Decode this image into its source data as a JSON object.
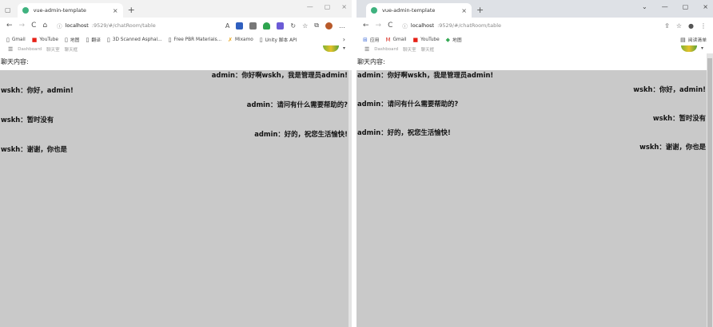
{
  "left_window": {
    "tab_title": "vue-admin-template",
    "url_host": "localhost",
    "url_rest": ":9529/#/chatRoom/table",
    "bookmarks": [
      "Gmail",
      "YouTube",
      "地图",
      "翻译",
      "3D Scanned Asphal...",
      "Free PBR Materials...",
      "Mixamo",
      "Unity 脚本 API"
    ],
    "breadcrumb": [
      "Dashboard",
      "聊天室",
      "聊天框"
    ],
    "chat_label": "聊天内容:",
    "messages": [
      {
        "text": "admin：你好啊wskh，我是管理员admin!",
        "align": "right"
      },
      {
        "text": "wskh：你好，admin!",
        "align": "left"
      },
      {
        "text": "admin：请问有什么需要帮助的?",
        "align": "right"
      },
      {
        "text": "wskh：暂时没有",
        "align": "left"
      },
      {
        "text": "admin：好的，祝您生活愉快!",
        "align": "right"
      },
      {
        "text": "wskh：谢谢，你也是",
        "align": "left"
      }
    ]
  },
  "right_window": {
    "tab_title": "vue-admin-template",
    "url_host": "localhost",
    "url_rest": ":9529/#/chatRoom/table",
    "bookmarks": [
      "应用",
      "Gmail",
      "YouTube",
      "地图"
    ],
    "reading_list": "阅读清单",
    "breadcrumb": [
      "Dashboard",
      "聊天室",
      "聊天框"
    ],
    "chat_label": "聊天内容:",
    "messages": [
      {
        "text": "admin：你好啊wskh，我是管理员admin!",
        "align": "left"
      },
      {
        "text": "wskh：你好，admin!",
        "align": "right"
      },
      {
        "text": "admin：请问有什么需要帮助的?",
        "align": "left"
      },
      {
        "text": "wskh：暂时没有",
        "align": "right"
      },
      {
        "text": "admin：好的，祝您生活愉快!",
        "align": "left"
      },
      {
        "text": "wskh：谢谢，你也是",
        "align": "right"
      }
    ]
  },
  "icons": {
    "back": "←",
    "forward": "→",
    "reload": "C",
    "home": "⌂",
    "info": "ⓘ",
    "close": "×",
    "new_tab": "+",
    "star": "☆",
    "menu": "⋮",
    "more": "…"
  },
  "colors": {
    "chat_bg": "#c9c9c9",
    "favicon": "#3fb27f"
  }
}
